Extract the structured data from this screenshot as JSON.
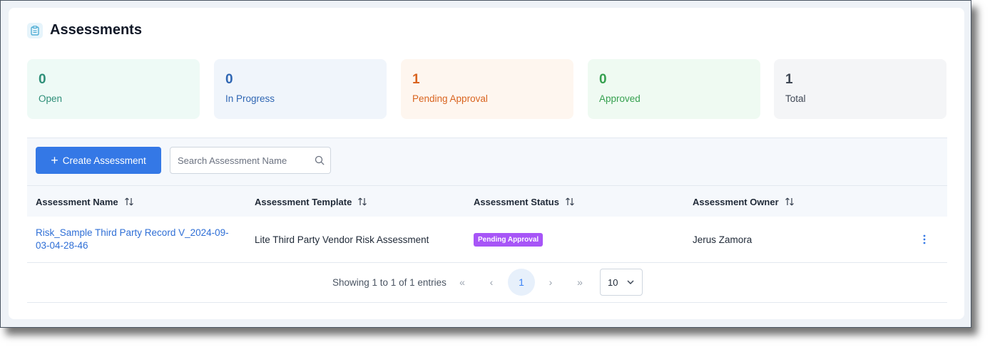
{
  "page": {
    "title": "Assessments",
    "icon": "clipboard-icon"
  },
  "summary": [
    {
      "key": "open",
      "value": "0",
      "label": "Open",
      "color": "#2f8f79"
    },
    {
      "key": "in_progress",
      "value": "0",
      "label": "In Progress",
      "color": "#2f66b3"
    },
    {
      "key": "pending",
      "value": "1",
      "label": "Pending Approval",
      "color": "#d9641f"
    },
    {
      "key": "approved",
      "value": "0",
      "label": "Approved",
      "color": "#35a04f"
    },
    {
      "key": "total",
      "value": "1",
      "label": "Total",
      "color": "#3f4754"
    }
  ],
  "toolbar": {
    "create_label": "Create Assessment",
    "search_placeholder": "Search Assessment Name"
  },
  "table": {
    "columns": [
      "Assessment Name",
      "Assessment Template",
      "Assessment Status",
      "Assessment Owner"
    ],
    "rows": [
      {
        "name": "Risk_Sample Third Party Record V_2024-09-03-04-28-46",
        "template": "Lite Third Party Vendor Risk Assessment",
        "status": "Pending Approval",
        "owner": "Jerus Zamora"
      }
    ]
  },
  "pagination": {
    "info": "Showing 1 to 1 of 1 entries",
    "first": "«",
    "prev": "‹",
    "current_page": "1",
    "next": "›",
    "last": "»",
    "page_size": "10"
  },
  "colors": {
    "accent": "#3478e6",
    "status_badge": "#a755f7",
    "link": "#2f6fd6"
  }
}
